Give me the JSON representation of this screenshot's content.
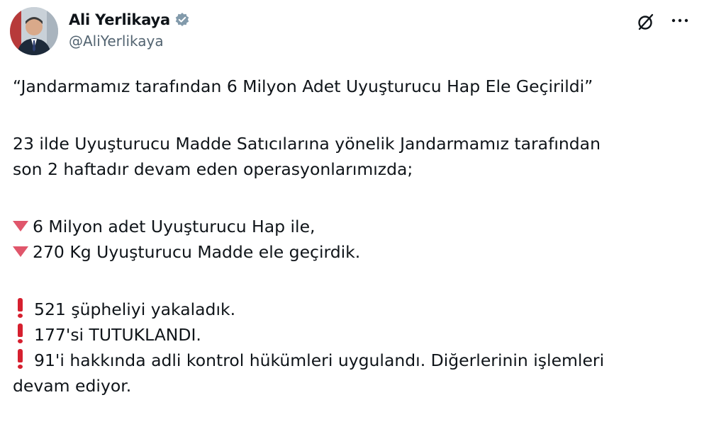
{
  "author": {
    "display_name": "Ali Yerlikaya",
    "handle": "@AliYerlikaya",
    "verified_icon": "verified-badge-icon"
  },
  "toolbar": {
    "grok_icon": "grok-icon",
    "more_icon": "more-options-icon"
  },
  "tweet": {
    "title": "“Jandarmamız tarafından 6 Milyon Adet Uyuşturucu Hap Ele Geçirildi”",
    "intro_line1": "23 ilde Uyuşturucu Madde Satıcılarına yönelik Jandarmamız tarafından",
    "intro_line2": "son 2 haftadır devam eden operasyonlarımızda;",
    "seizures": [
      {
        "icon": "red-down-triangle-icon",
        "text": "6 Milyon adet Uyuşturucu Hap ile,"
      },
      {
        "icon": "red-down-triangle-icon",
        "text": "270 Kg Uyuşturucu Madde ele geçirdik."
      }
    ],
    "results": [
      {
        "icon": "red-exclamation-icon",
        "text": "521 şüpheliyi yakaladık."
      },
      {
        "icon": "red-exclamation-icon",
        "text": "177'si TUTUKLANDI."
      },
      {
        "icon": "red-exclamation-icon",
        "text": "91'i hakkında adli kontrol hükümleri uygulandı. Diğerlerinin işlemleri"
      }
    ],
    "final_line": "devam ediyor."
  },
  "colors": {
    "text": "#0f1419",
    "secondary": "#536471",
    "verified": "#829aab",
    "triangle": "#e0566b",
    "exclamation": "#d6202f"
  }
}
